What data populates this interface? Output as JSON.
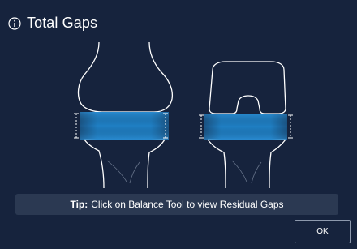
{
  "dialog": {
    "title": "Total Gaps",
    "icon": "info-icon",
    "tip_label": "Tip:",
    "tip_text": "Click on Balance Tool to view Residual Gaps",
    "ok_label": "OK"
  },
  "colors": {
    "background": "#16233d",
    "gap_band": "#1f7fc4",
    "tip_background": "#2b3952",
    "outline": "#ffffff"
  },
  "illustrations": [
    "knee-joint-gap-icon",
    "knee-implant-gap-icon"
  ]
}
